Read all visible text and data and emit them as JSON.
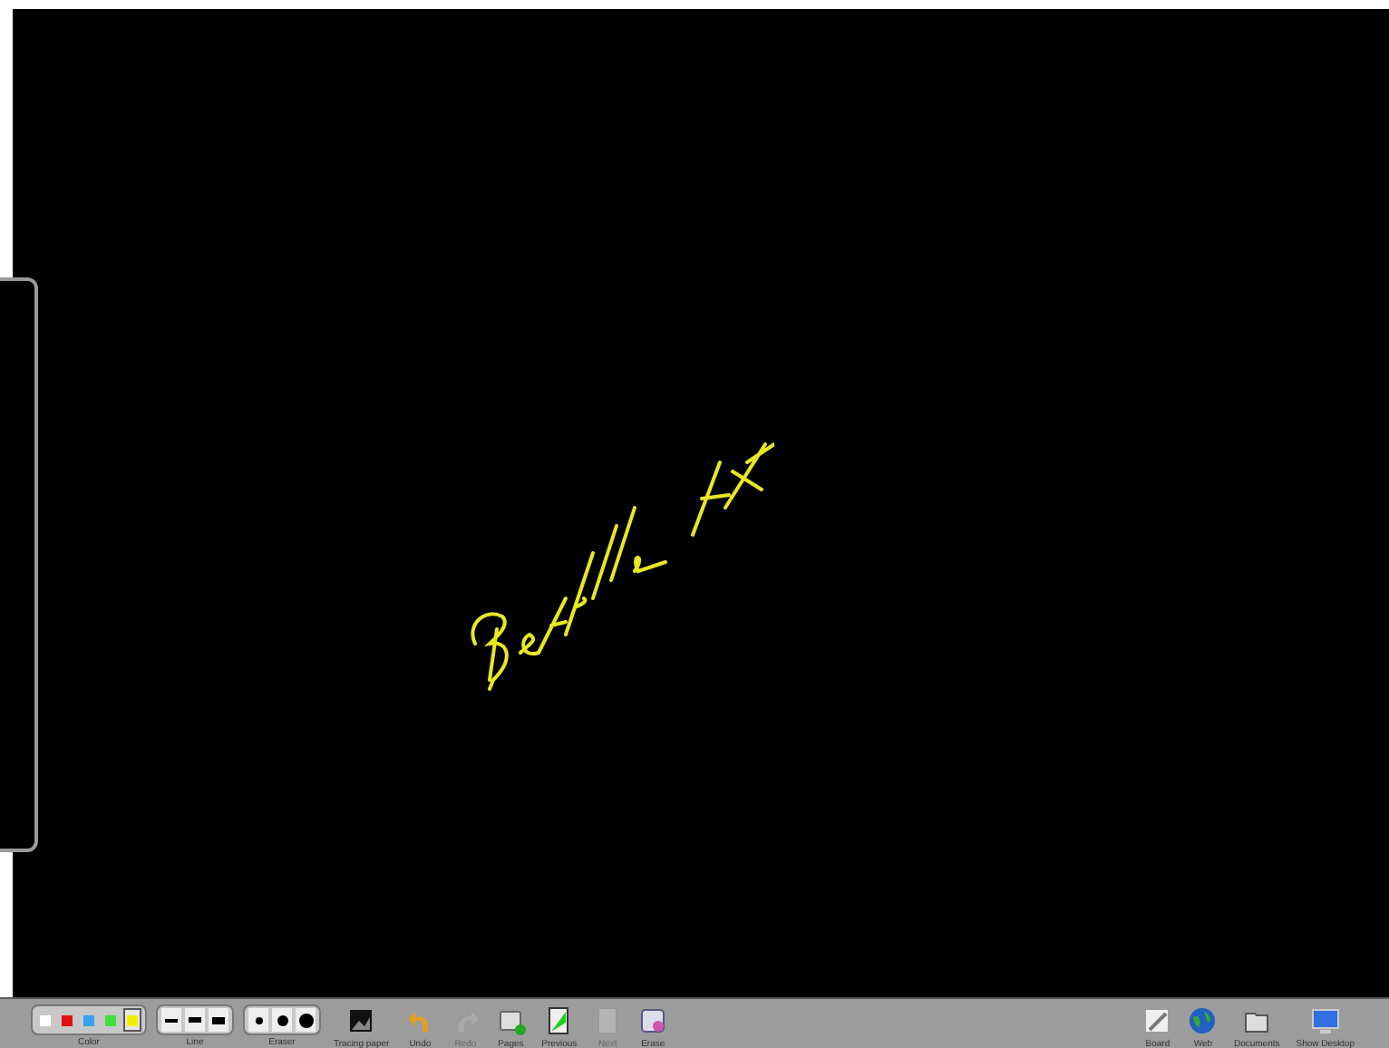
{
  "toolbar": {
    "groups": [
      {
        "kind": "colors",
        "label": "Color",
        "swatches": [
          {
            "color": "#ffffff",
            "selected": false
          },
          {
            "color": "#e01010",
            "selected": false
          },
          {
            "color": "#3aa0f0",
            "selected": false
          },
          {
            "color": "#40e040",
            "selected": false
          },
          {
            "color": "#f0f000",
            "selected": true
          }
        ]
      },
      {
        "kind": "lines",
        "label": "Line"
      },
      {
        "kind": "eraser",
        "label": "Eraser"
      },
      {
        "kind": "button",
        "label": "Tracing paper",
        "disabled": false
      },
      {
        "kind": "button",
        "label": "Undo",
        "disabled": false
      },
      {
        "kind": "button",
        "label": "Redo",
        "disabled": true
      },
      {
        "kind": "button",
        "label": "Pages",
        "disabled": false
      },
      {
        "kind": "button",
        "label": "Previous",
        "disabled": false
      },
      {
        "kind": "button",
        "label": "Next",
        "disabled": true
      },
      {
        "kind": "button",
        "label": "Erase",
        "disabled": false
      },
      {
        "kind": "spacer"
      },
      {
        "kind": "button",
        "label": "Board",
        "disabled": false
      },
      {
        "kind": "button",
        "label": "Web",
        "disabled": false
      },
      {
        "kind": "button",
        "label": "Documents",
        "disabled": false
      },
      {
        "kind": "button",
        "label": "Show Desktop",
        "disabled": false
      }
    ]
  }
}
